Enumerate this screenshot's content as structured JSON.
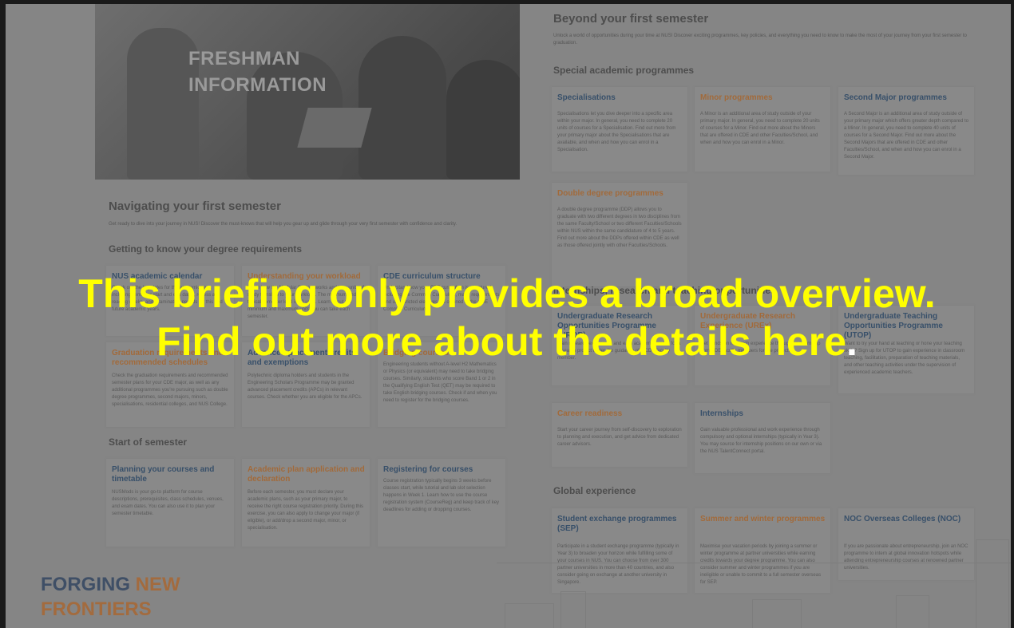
{
  "hero": {
    "line1": "FRESHMAN",
    "line2": "INFORMATION"
  },
  "left": {
    "heading": "Navigating your first semester",
    "intro": "Get ready to dive into your journey in NUS! Discover the must-knows that will help you gear up and glide through your very first semester with confidence and clarity.",
    "degree_heading": "Getting to know your degree requirements",
    "cards_row1": [
      {
        "title": "NUS academic calendar",
        "body": "Check out the key dates for the academic year, including semester start and end dates, recess and reading weeks, and examination periods for this and future academic years."
      },
      {
        "title": "Understanding your workload",
        "body": "Learn how the Modular System works and how units of study translate to your workload. The minimum and typical semester load is 20 units. Learn about the minimum and maximum units you can take each semester."
      },
      {
        "title": "CDE curriculum structure",
        "body": "Understand how your CDE curriculum is structured, including the Common Curriculum, major requirements and unrestricted electives, as outlined in the CDE Common Curriculum."
      }
    ],
    "cards_row2": [
      {
        "title": "Graduation requirements and recommended schedules",
        "body": "Check the graduation requirements and recommended semester plans for your CDE major, as well as any additional programmes you're pursuing such as double degree programmes, second majors, minors, specialisations, residential colleges, and NUS College."
      },
      {
        "title": "Advanced placement credits and exemptions",
        "body": "Polytechnic diploma holders and students in the Engineering Scholars Programme may be granted advanced placement credits (APCs) in relevant courses. Check whether you are eligible for the APCs."
      },
      {
        "title": "Bridging courses",
        "body": "Engineering students without A-level H2 Mathematics or Physics (or equivalent) may need to take bridging courses. Similarly, students who score Band 1 or 2 in the Qualifying English Test (QET) may be required to take English bridging courses. Check if and when you need to register for the bridging courses."
      }
    ],
    "start_heading": "Start of semester",
    "cards_row3": [
      {
        "title": "Planning your courses and timetable",
        "body": "NUSMods is your go-to platform for course descriptions, prerequisites, class schedules, venues, and exam dates. You can also use it to plan your semester timetable."
      },
      {
        "title": "Academic plan application and declaration",
        "body": "Before each semester, you must declare your academic plans, such as your primary major, to receive the right course registration priority. During this exercise, you can also apply to change your major (if eligible), or add/drop a second major, minor, or specialisation."
      },
      {
        "title": "Registering for courses",
        "body": "Course registration typically begins 3 weeks before classes start, while tutorial and lab slot selection happens in Week 1. Learn how to use the course registration system (CourseReg) and keep track of key deadlines for adding or dropping courses."
      }
    ]
  },
  "right": {
    "heading": "Beyond your first semester",
    "intro": "Unlock a world of opportunities during your time at NUS! Discover exciting programmes, key policies, and everything you need to know to make the most of your journey from your first semester to graduation.",
    "special_heading": "Special academic programmes",
    "special_cards": [
      {
        "title": "Specialisations",
        "body": "Specialisations let you dive deeper into a specific area within your major. In general, you need to complete 20 units of courses for a Specialisation. Find out more from your primary major about the Specialisations that are available, and when and how you can enrol in a Specialisation."
      },
      {
        "title": "Minor programmes",
        "body": "A Minor is an additional area of study outside of your primary major. In general, you need to complete 20 units of courses for a Minor. Find out more about the Minors that are offered in CDE and other Faculties/School, and when and how you can enrol in a Minor."
      },
      {
        "title": "Second Major programmes",
        "body": "A Second Major is an additional area of study outside of your primary major which offers greater depth compared to a Minor. In general, you need to complete 40 units of courses for a Second Major. Find out more about the Second Majors that are offered in CDE and other Faculties/School, and when and how you can enrol in a Second Major."
      }
    ],
    "ddp_card": {
      "title": "Double degree programmes",
      "body": "A double degree programme (DDP) allows you to graduate with two different degrees in two disciplines from the same Faculty/School or two different Faculties/Schools within NUS within the same candidature of 4 to 5 years. Find out more about the DDPs offered within CDE as well as those offered jointly with other Faculties/Schools."
    },
    "research_heading": "Internships, research and teaching opportunities",
    "research_cards": [
      {
        "title": "Undergraduate Research Opportunities Programme (UROP)",
        "body": "Gain research experience and earn academic credits for a research project under the guidance of a CDE faculty member."
      },
      {
        "title": "Undergraduate Research Experience (UREx)",
        "body": "Get hands-on research experience through an internship from CDE faculty members for the project."
      },
      {
        "title": "Undergraduate Teaching Opportunities Programme (UTOP)",
        "body": "Want to try your hand at teaching or hone your teaching skills? Sign up for UTOP to gain experience in classroom teaching, facilitation, preparation of teaching materials, and other teaching activities under the supervision of experienced academic teachers."
      }
    ],
    "career_cards": [
      {
        "title": "Career readiness",
        "body": "Start your career journey from self-discovery to exploration to planning and execution, and get advice from dedicated career advisors."
      },
      {
        "title": "Internships",
        "body": "Gain valuable professional and work experience through compulsory and optional internships (typically in Year 3). You may source for internship positions on our own or via the NUS TalentConnect portal."
      }
    ],
    "global_heading": "Global experience",
    "global_cards": [
      {
        "title": "Student exchange programmes (SEP)",
        "body": "Participate in a student exchange programme (typically in Year 3) to broaden your horizon while fulfilling some of your courses in NUS. You can choose from over 300 partner universities in more than 40 countries, and also consider going on exchange at another university in Singapore."
      },
      {
        "title": "Summer and winter programmes",
        "body": "Maximise your vacation periods by joining a summer or winter programme at partner universities while earning credits towards your degree programme. You can also consider summer and winter programmes if you are ineligible or unable to commit to a full semester overseas for SEP."
      },
      {
        "title": "NOC Overseas Colleges (NOC)",
        "body": "If you are passionate about entrepreneurship, join an NOC programme to intern at global innovation hotspots while attending entrepreneurship courses at renowned partner universities."
      }
    ]
  },
  "overlay": {
    "line1": "This briefing only provides a broad overview.",
    "line2": "Find out more about the details here",
    "line2_end": "."
  },
  "brand": {
    "word1": "FORGING",
    "word2": "NEW",
    "word3": "FRONTIERS"
  },
  "colors": {
    "blue_title": "#38506a",
    "orange_title": "#a26a3a",
    "overlay_text": "#ffff00"
  }
}
